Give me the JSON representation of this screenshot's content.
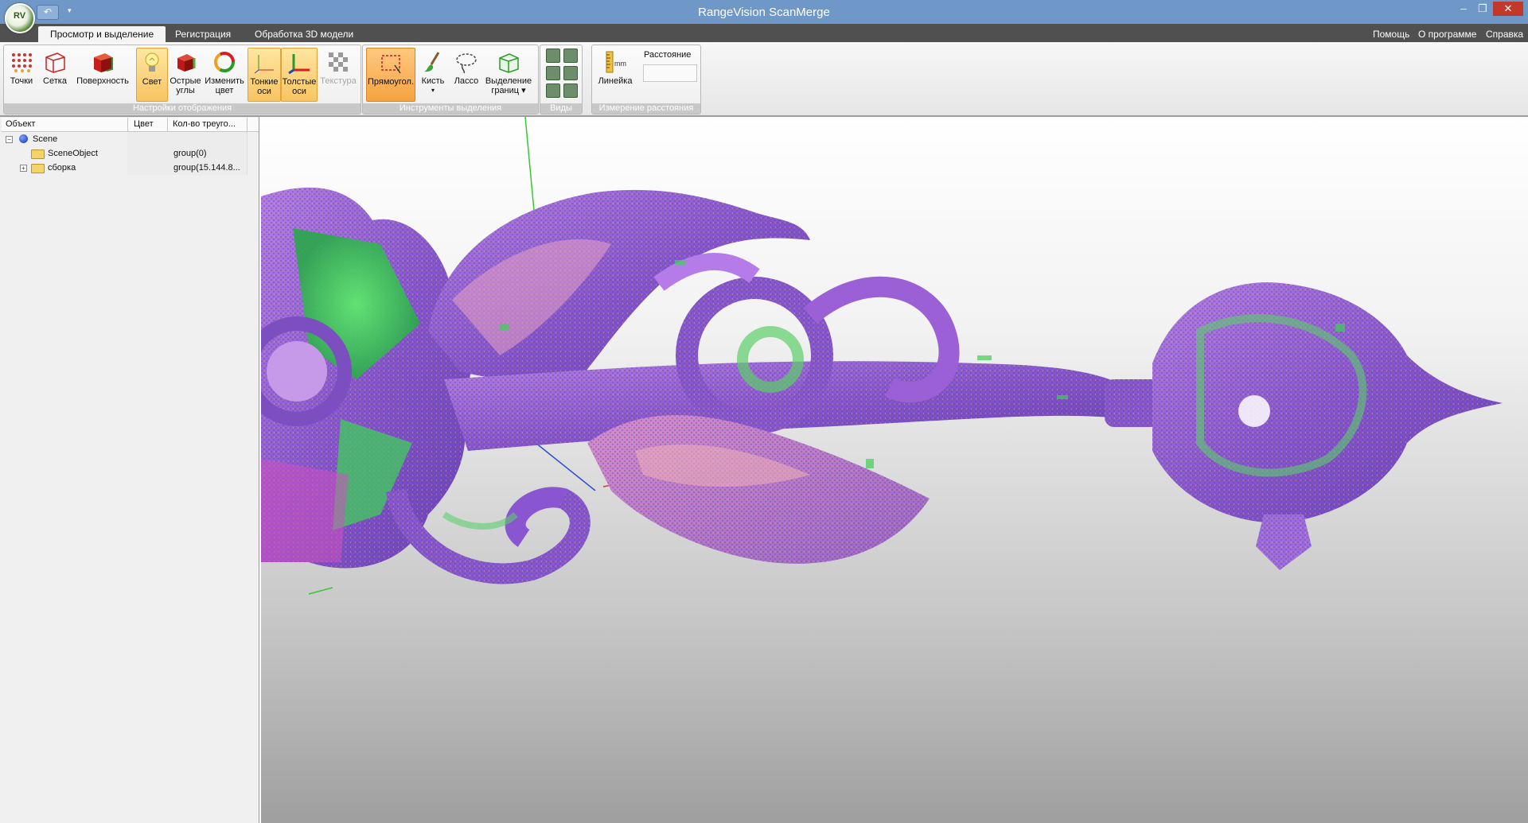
{
  "window": {
    "title": "RangeVision ScanMerge",
    "logo_text": "RV",
    "minimize": "–",
    "maximize": "❐",
    "close": "✕"
  },
  "ribbon_tabs": [
    {
      "label": "Просмотр и выделение",
      "active": true
    },
    {
      "label": "Регистрация",
      "active": false
    },
    {
      "label": "Обработка 3D модели",
      "active": false
    }
  ],
  "top_links": {
    "help": "Помощь",
    "about": "О программе",
    "reference": "Справка"
  },
  "groups": {
    "display": {
      "caption": "Настройки отображения",
      "buttons": [
        {
          "label": "Точки",
          "icon": "points-icon"
        },
        {
          "label": "Сетка",
          "icon": "mesh-icon"
        },
        {
          "label": "Поверхность",
          "icon": "surface-icon"
        },
        {
          "label": "Свет",
          "icon": "light-bulb-icon",
          "active": true
        },
        {
          "label1": "Острые",
          "label2": "углы",
          "icon": "sharp-edges-icon"
        },
        {
          "label1": "Изменить",
          "label2": "цвет",
          "icon": "change-color-icon"
        },
        {
          "label1": "Тонкие",
          "label2": "оси",
          "icon": "thin-axes-icon",
          "active": true
        },
        {
          "label1": "Толстые",
          "label2": "оси",
          "icon": "thick-axes-icon",
          "active": true
        },
        {
          "label": "Текстура",
          "icon": "texture-icon",
          "disabled": true
        }
      ]
    },
    "selection": {
      "caption": "Инструменты выделения",
      "buttons": [
        {
          "label": "Прямоугол.",
          "icon": "rectangle-select-icon",
          "active": true
        },
        {
          "label": "Кисть",
          "icon": "brush-icon",
          "dropdown": "▾"
        },
        {
          "label": "Лассо",
          "icon": "lasso-icon"
        },
        {
          "label1": "Выделение",
          "label2": "границ ▾",
          "icon": "border-select-icon"
        }
      ]
    },
    "views": {
      "caption": "Виды"
    },
    "measure": {
      "caption": "Измерение расстояния",
      "ruler_label": "Линейка",
      "ruler_unit": "mm",
      "distance_label": "Расстояние",
      "distance_value": ""
    }
  },
  "tree": {
    "columns": [
      "Объект",
      "Цвет",
      "Кол-во треуго..."
    ],
    "rows": [
      {
        "name": "Scene",
        "expander": "−",
        "count": ""
      },
      {
        "name": "SceneObject",
        "count": "group(0)"
      },
      {
        "name": "сборка",
        "expander": "+",
        "count": "group(15.144.8..."
      }
    ]
  },
  "colors": {
    "titlebar": "#6f97c8",
    "tabbar": "#505050",
    "active_button": "#f8c462",
    "model_purple": "#9b5fd6",
    "model_green": "#3fcf5a"
  }
}
